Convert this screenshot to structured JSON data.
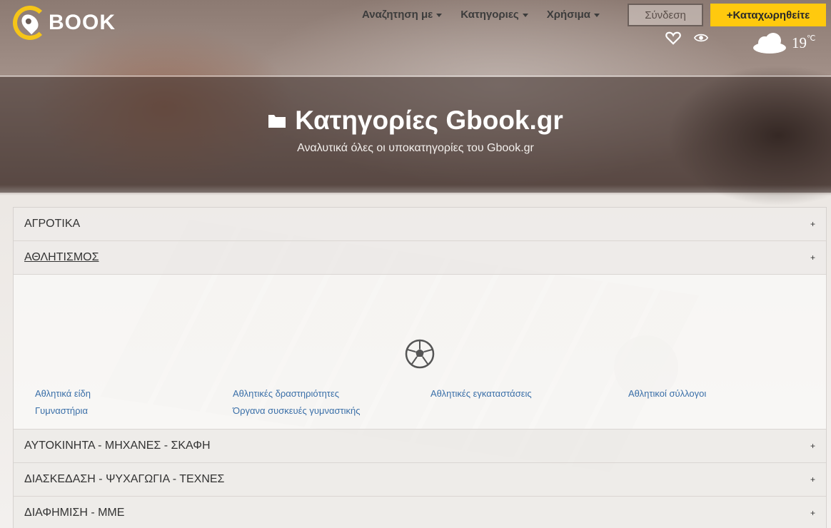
{
  "header": {
    "logo_text": "BOOK",
    "logo_letter": "G",
    "nav": [
      {
        "label": "Αναζητηση με"
      },
      {
        "label": "Κατηγοριες"
      },
      {
        "label": "Χρήσιμα"
      }
    ],
    "login_label": "Σύνδεση",
    "register_label": "+Καταχωρηθείτε",
    "weather": {
      "temp": "19",
      "unit": "℃",
      "icon": "cloud-icon"
    }
  },
  "hero": {
    "title": "Κατηγορίες Gbook.gr",
    "subtitle": "Αναλυτικά όλες οι υποκατηγορίες του Gbook.gr",
    "icon": "folder-icon"
  },
  "categories": [
    {
      "label": "ΑΓΡΟΤΙΚΑ",
      "toggle": "+"
    },
    {
      "label": "ΑΘΛΗΤΙΣΜΟΣ",
      "toggle": "+",
      "icon": "football-icon",
      "subcategories": [
        "Αθλητικά είδη",
        "Αθλητικές δραστηριότητες",
        "Αθλητικές εγκαταστάσεις",
        "Αθλητικοί σύλλογοι",
        "Γυμναστήρια",
        "Όργανα συσκευές γυμναστικής"
      ]
    },
    {
      "label": "ΑΥΤΟΚΙΝΗΤΑ - ΜΗΧΑΝΕΣ - ΣΚΑΦΗ",
      "toggle": "+"
    },
    {
      "label": "ΔΙΑΣΚΕΔΑΣΗ - ΨΥΧΑΓΩΓΙΑ - ΤΕΧΝΕΣ",
      "toggle": "+"
    },
    {
      "label": "ΔΙΑΦΗΜΙΣΗ - ΜΜΕ",
      "toggle": "+"
    }
  ],
  "colors": {
    "accent": "#ffc90e",
    "link": "#3a6fa8"
  }
}
